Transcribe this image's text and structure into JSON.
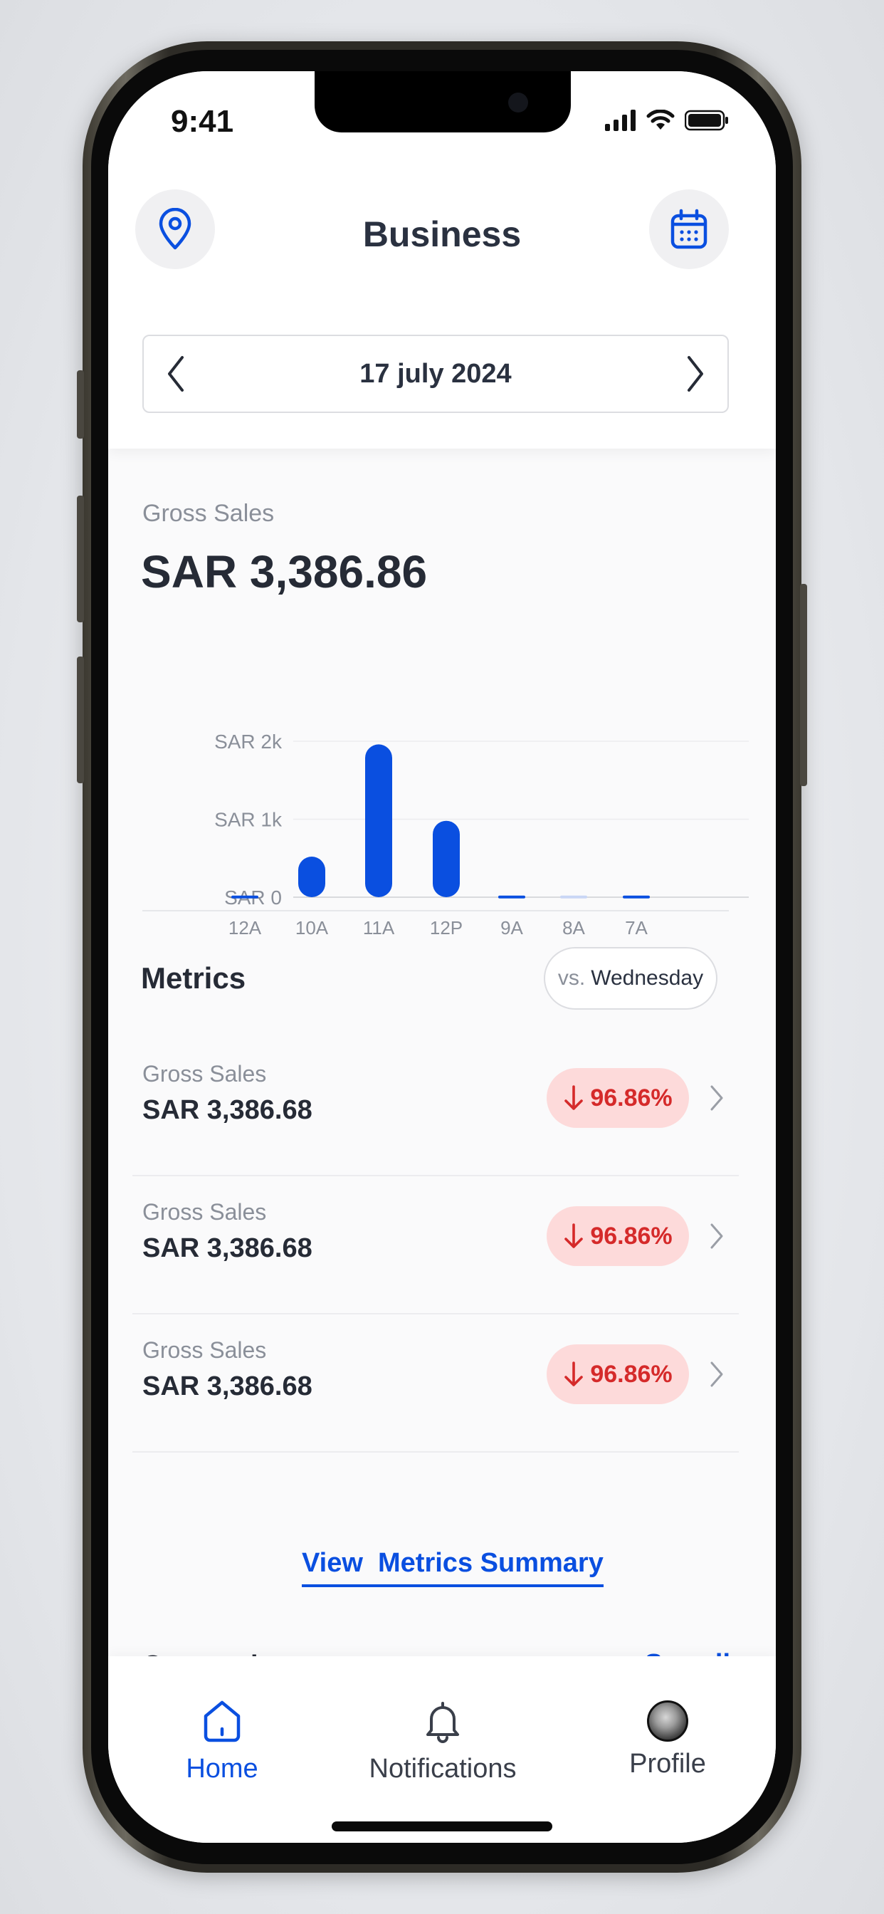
{
  "status_bar": {
    "time": "9:41"
  },
  "header": {
    "title": "Business",
    "left_icon": "location-pin-icon",
    "right_icon": "calendar-icon",
    "date": "17 july 2024"
  },
  "gross_sales": {
    "label": "Gross Sales",
    "amount": "SAR 3,386.86"
  },
  "chart_data": {
    "type": "bar",
    "categories": [
      "12A",
      "10A",
      "11A",
      "12P",
      "9A",
      "8A",
      "7A"
    ],
    "values": [
      20,
      520,
      1960,
      980,
      20,
      20,
      20
    ],
    "y_tick_labels": [
      "SAR 0",
      "SAR 1k",
      "SAR 2k"
    ],
    "y_ticks": [
      0,
      1000,
      2000
    ],
    "ylim": [
      0,
      2000
    ],
    "bar_colors": [
      "#0a4fe0",
      "#0a4fe0",
      "#0a4fe0",
      "#0a4fe0",
      "#0a4fe0",
      "#c9d6f5",
      "#0a4fe0"
    ],
    "grid": true,
    "xlabel": "",
    "ylabel": ""
  },
  "metrics": {
    "title": "Metrics",
    "compare_prefix": "vs.",
    "compare_day": "Wednesday",
    "rows": [
      {
        "label": "Gross Sales",
        "value": "SAR 3,386.68",
        "change": "96.86%"
      },
      {
        "label": "Gross Sales",
        "value": "SAR 3,386.68",
        "change": "96.86%"
      },
      {
        "label": "Gross Sales",
        "value": "SAR 3,386.68",
        "change": "96.86%"
      }
    ],
    "summary_link": "View  Metrics Summary"
  },
  "companies": {
    "title": "Companies",
    "see_all": "See all"
  },
  "tabbar": {
    "items": [
      {
        "label": "Home",
        "icon": "home-icon",
        "active": true
      },
      {
        "label": "Notifications",
        "icon": "bell-icon",
        "active": false
      },
      {
        "label": "Profile",
        "icon": "avatar",
        "active": false
      }
    ]
  },
  "colors": {
    "accent": "#0a4fe0",
    "negative": "#d52a2a",
    "negative_bg": "#fddada"
  }
}
